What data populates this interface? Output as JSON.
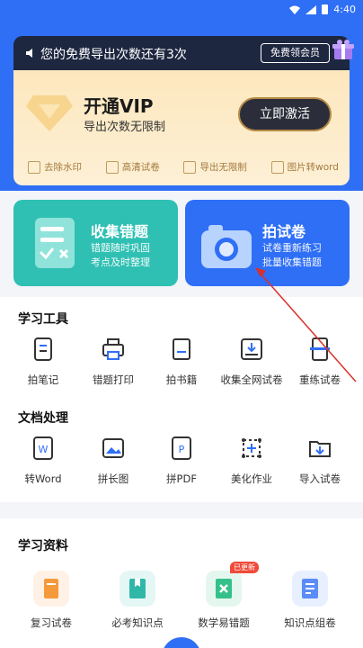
{
  "status": {
    "time": "4:40"
  },
  "notice": {
    "text": "您的免费导出次数还有3次",
    "button": "免费领会员"
  },
  "vip": {
    "title": "开通VIP",
    "subtitle": "导出次数无限制",
    "activate": "立即激活",
    "benefits": [
      {
        "label": "去除水印",
        "icon": "watermark-icon"
      },
      {
        "label": "高清试卷",
        "icon": "hd-icon"
      },
      {
        "label": "导出无限制",
        "icon": "export-icon"
      },
      {
        "label": "图片转word",
        "icon": "word-icon"
      }
    ]
  },
  "cards": [
    {
      "title": "收集错题",
      "desc1": "错题随时巩固",
      "desc2": "考点及时整理"
    },
    {
      "title": "拍试卷",
      "desc1": "试卷重新练习",
      "desc2": "批量收集错题"
    }
  ],
  "study_tools": {
    "title": "学习工具",
    "items": [
      "拍笔记",
      "错题打印",
      "拍书籍",
      "收集全网试卷",
      "重练试卷"
    ]
  },
  "doc_tools": {
    "title": "文档处理",
    "items": [
      "转Word",
      "拼长图",
      "拼PDF",
      "美化作业",
      "导入试卷"
    ]
  },
  "resources": {
    "title": "学习资料",
    "badge": "已更新",
    "items": [
      "复习试卷",
      "必考知识点",
      "数学易错题",
      "知识点组卷"
    ]
  },
  "colors": {
    "primary": "#2f6ff6",
    "teal": "#2fc0b3",
    "vip_gold": "#fde7bd",
    "dark": "#1e2740"
  }
}
